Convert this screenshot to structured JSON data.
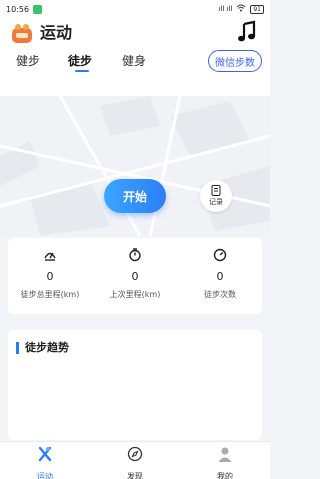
{
  "status_bar": {
    "time": "10:56",
    "signal": "ıll ıll",
    "battery": "91"
  },
  "header": {
    "title": "运动"
  },
  "tabs": [
    {
      "label": "健步"
    },
    {
      "label": "徒步"
    },
    {
      "label": "健身"
    }
  ],
  "wechat_steps_button": "微信步数",
  "start_button": "开始",
  "record_button": "记录",
  "stats": [
    {
      "value": "0",
      "label": "徒步总里程(km)",
      "icon": "distance-icon"
    },
    {
      "value": "0",
      "label": "上次里程(km)",
      "icon": "timer-icon"
    },
    {
      "value": "0",
      "label": "徒步次数",
      "icon": "gauge-icon"
    }
  ],
  "trend": {
    "title": "徒步趋势"
  },
  "bottom_nav": [
    {
      "label": "运动",
      "icon": "sport-icon"
    },
    {
      "label": "发现",
      "icon": "compass-icon"
    },
    {
      "label": "我的",
      "icon": "profile-icon"
    }
  ],
  "colors": {
    "accent": "#2b7cf6",
    "wechat_button": "#3e63f0",
    "background": "#f3f4f8"
  }
}
